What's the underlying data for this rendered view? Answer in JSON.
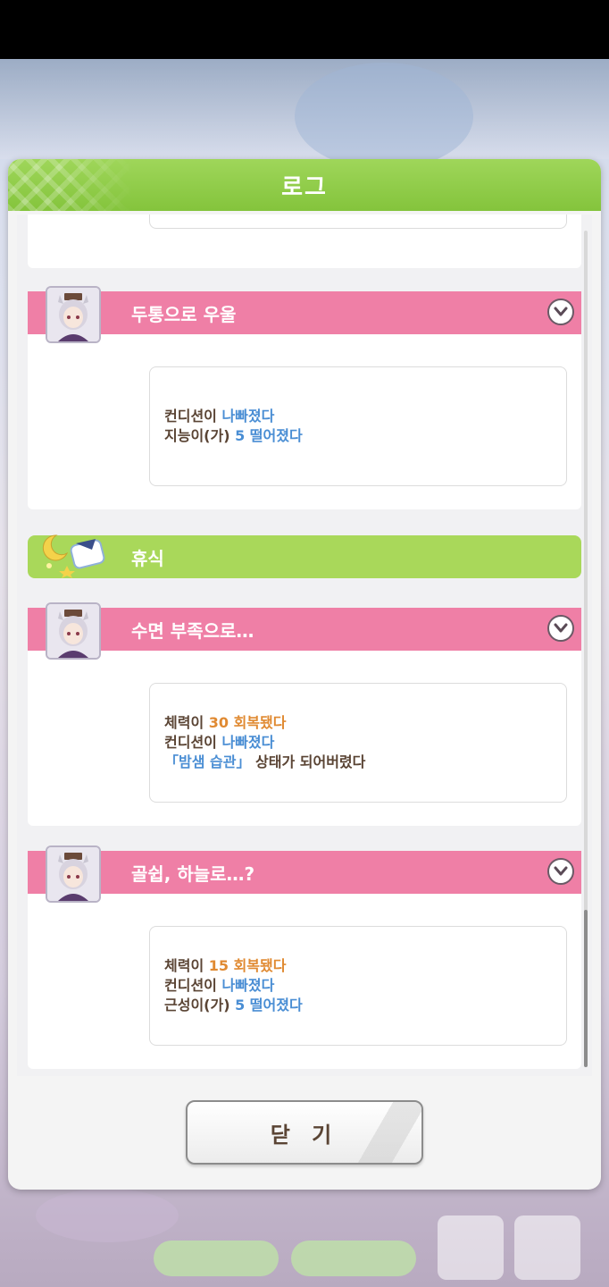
{
  "dialog": {
    "title": "로그",
    "close_label": "닫 기"
  },
  "events": [
    {
      "type": "event",
      "title": "두통으로 우울",
      "lines": [
        [
          {
            "text": "컨디션이 ",
            "style": "plain"
          },
          {
            "text": "나빠졌다",
            "style": "blue"
          }
        ],
        [
          {
            "text": "지능이(가) ",
            "style": "plain"
          },
          {
            "text": "5 떨어졌다",
            "style": "blue"
          }
        ]
      ]
    },
    {
      "type": "action",
      "title": "휴식"
    },
    {
      "type": "event",
      "title": "수면 부족으로…",
      "lines": [
        [
          {
            "text": "체력이 ",
            "style": "plain"
          },
          {
            "text": "30 회복됐다",
            "style": "orange"
          }
        ],
        [
          {
            "text": "컨디션이 ",
            "style": "plain"
          },
          {
            "text": "나빠졌다",
            "style": "blue"
          }
        ],
        [
          {
            "text": "「밤샘 습관」",
            "style": "blue"
          },
          {
            "text": " 상태가 되어버렸다",
            "style": "plain"
          }
        ]
      ]
    },
    {
      "type": "event",
      "title": "골쉽, 하늘로…?",
      "lines": [
        [
          {
            "text": "체력이 ",
            "style": "plain"
          },
          {
            "text": "15 회복됐다",
            "style": "orange"
          }
        ],
        [
          {
            "text": "컨디션이 ",
            "style": "plain"
          },
          {
            "text": "나빠졌다",
            "style": "blue"
          }
        ],
        [
          {
            "text": "근성이(가) ",
            "style": "plain"
          },
          {
            "text": "5 떨어졌다",
            "style": "blue"
          }
        ]
      ]
    }
  ],
  "colors": {
    "header_green": "#84c43c",
    "event_pink": "#ef7fa6",
    "value_blue": "#4a8ed4",
    "value_orange": "#e08a32",
    "text_brown": "#5a4434"
  },
  "icons": {
    "expand": "chevron-down-icon",
    "rest": "moon-pillow-icon",
    "character": "character-portrait"
  }
}
